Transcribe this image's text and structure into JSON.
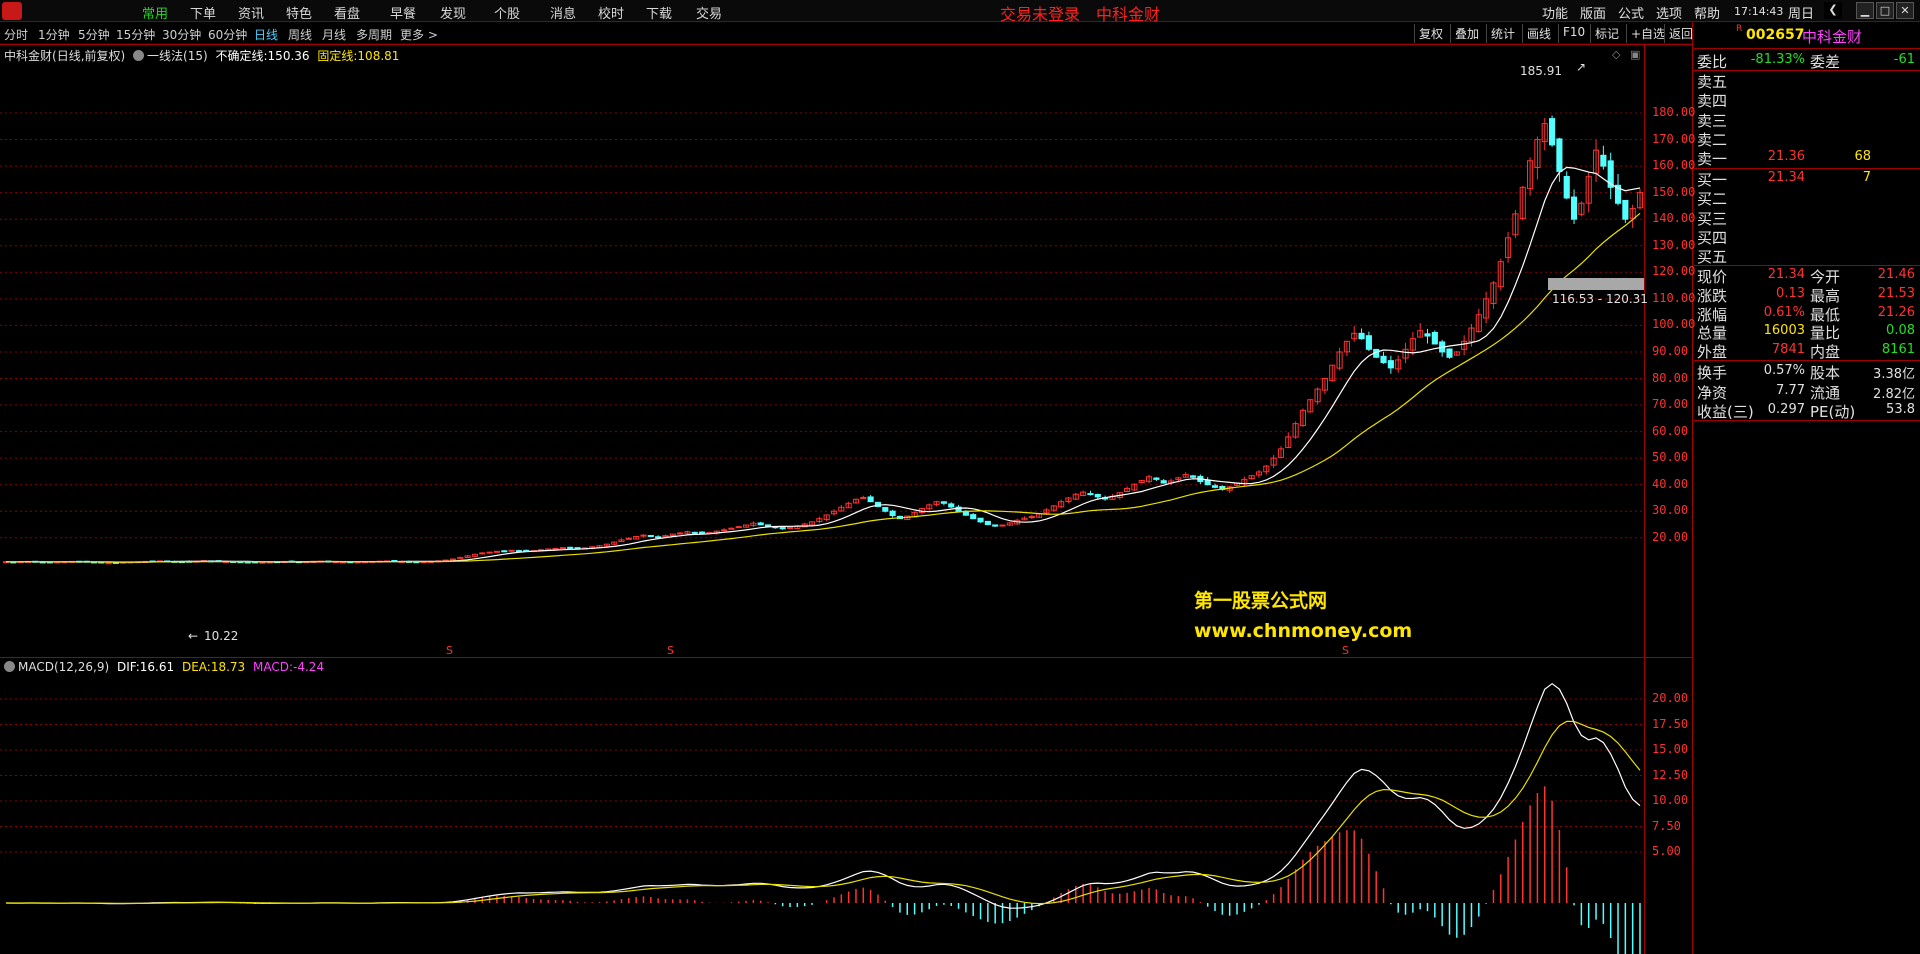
{
  "menu": {
    "items": [
      "常用",
      "下单",
      "资讯",
      "特色",
      "看盘",
      "早餐",
      "发现",
      "个股",
      "消息",
      "校时",
      "下载",
      "交易"
    ],
    "active_index": 0,
    "login_status": "交易未登录",
    "stock_title": "中科金财",
    "right_items": [
      "功能",
      "版面",
      "公式",
      "选项",
      "帮助"
    ],
    "clock": "17:14:43",
    "weekday": "周日"
  },
  "periods": {
    "items": [
      "分时",
      "1分钟",
      "5分钟",
      "15分钟",
      "30分钟",
      "60分钟",
      "日线",
      "周线",
      "月线",
      "多周期",
      "更多 >"
    ],
    "active_index": 6
  },
  "toolbar": [
    "复权",
    "叠加",
    "统计",
    "画线",
    "F10",
    "标记",
    "+自选",
    "返回"
  ],
  "main_legend": {
    "name": "中科金财",
    "mode": "(日线,前复权)",
    "indicator": "一线法(15)",
    "uncertain_label": "不确定线:",
    "uncertain_value": "150.36",
    "fixed_label": "固定线:",
    "fixed_value": "108.81"
  },
  "annotations": {
    "high": "185.91",
    "low": "10.22",
    "range": "116.53 - 120.31",
    "marker": "S"
  },
  "watermark": {
    "line1": "第一股票公式网",
    "line2": "www.chnmoney.com"
  },
  "macd_legend": {
    "name": "MACD(12,26,9)",
    "dif_label": "DIF:",
    "dif_value": "16.61",
    "dea_label": "DEA:",
    "dea_value": "18.73",
    "macd_label": "MACD:",
    "macd_value": "-4.24"
  },
  "colors": {
    "up": "#ff3232",
    "down": "#54ffff",
    "ma1": "#ffffff",
    "ma2": "#e8e000",
    "axis": "#ff3030",
    "grid": "#8a0000"
  },
  "price_axis": [
    "180.00",
    "170.00",
    "160.00",
    "150.00",
    "140.00",
    "130.00",
    "120.00",
    "110.00",
    "100.00",
    "90.00",
    "80.00",
    "70.00",
    "60.00",
    "50.00",
    "40.00",
    "30.00",
    "20.00"
  ],
  "macd_axis": [
    "20.00",
    "17.50",
    "15.00",
    "12.50",
    "10.00",
    "7.50",
    "5.00"
  ],
  "quote": {
    "code": "002657",
    "name": "中科金财",
    "badge": "R",
    "weibi_label": "委比",
    "weibi_value": "-81.33%",
    "weicha_label": "委差",
    "weicha_value": "-61",
    "asks": [
      {
        "label": "卖五",
        "price": "",
        "vol": ""
      },
      {
        "label": "卖四",
        "price": "",
        "vol": ""
      },
      {
        "label": "卖三",
        "price": "",
        "vol": ""
      },
      {
        "label": "卖二",
        "price": "",
        "vol": ""
      },
      {
        "label": "卖一",
        "price": "21.36",
        "vol": "68"
      }
    ],
    "bids": [
      {
        "label": "买一",
        "price": "21.34",
        "vol": "7"
      },
      {
        "label": "买二",
        "price": "",
        "vol": ""
      },
      {
        "label": "买三",
        "price": "",
        "vol": ""
      },
      {
        "label": "买四",
        "price": "",
        "vol": ""
      },
      {
        "label": "买五",
        "price": "",
        "vol": ""
      }
    ],
    "stats": [
      {
        "l1": "现价",
        "v1": "21.34",
        "c1": "#ff3232",
        "l2": "今开",
        "v2": "21.46",
        "c2": "#ff3232"
      },
      {
        "l1": "涨跌",
        "v1": "0.13",
        "c1": "#ff3232",
        "l2": "最高",
        "v2": "21.53",
        "c2": "#ff3232"
      },
      {
        "l1": "涨幅",
        "v1": "0.61%",
        "c1": "#ff3232",
        "l2": "最低",
        "v2": "21.26",
        "c2": "#ff3232"
      },
      {
        "l1": "总量",
        "v1": "16003",
        "c1": "#ffe600",
        "l2": "量比",
        "v2": "0.08",
        "c2": "#20e020"
      },
      {
        "l1": "外盘",
        "v1": "7841",
        "c1": "#ff3232",
        "l2": "内盘",
        "v2": "8161",
        "c2": "#20e020"
      }
    ],
    "fundamentals": [
      {
        "l1": "换手",
        "v1": "0.57%",
        "l2": "股本",
        "v2": "3.38亿"
      },
      {
        "l1": "净资",
        "v1": "7.77",
        "l2": "流通",
        "v2": "2.82亿"
      },
      {
        "l1": "收益(三)",
        "v1": "0.297",
        "l2": "PE(动)",
        "v2": "53.8"
      }
    ]
  },
  "chart_data": {
    "type": "candlestick",
    "description_units": "price",
    "ylim": [
      5,
      190
    ],
    "close": [
      11.0,
      10.9,
      11.0,
      11.1,
      11.0,
      10.9,
      10.8,
      10.9,
      11.0,
      11.1,
      11.0,
      10.9,
      10.8,
      10.7,
      10.6,
      10.7,
      10.8,
      10.9,
      11.0,
      11.1,
      11.2,
      11.3,
      11.2,
      11.1,
      11.0,
      11.1,
      11.2,
      11.4,
      11.3,
      11.2,
      11.1,
      11.0,
      10.9,
      10.8,
      10.7,
      10.8,
      10.9,
      11.0,
      11.1,
      11.0,
      10.9,
      11.0,
      11.1,
      11.2,
      11.1,
      11.0,
      10.9,
      10.8,
      10.9,
      11.0,
      11.1,
      11.2,
      11.3,
      11.2,
      11.1,
      11.0,
      10.9,
      11.0,
      11.1,
      11.3,
      11.6,
      12.0,
      12.6,
      13.2,
      13.8,
      14.3,
      14.6,
      14.9,
      15.1,
      15.3,
      15.1,
      14.9,
      15.2,
      15.5,
      15.8,
      16.0,
      16.3,
      16.1,
      15.9,
      16.2,
      16.6,
      17.0,
      17.6,
      18.4,
      19.2,
      19.8,
      20.5,
      21.0,
      20.6,
      20.2,
      20.8,
      21.4,
      21.8,
      22.3,
      22.0,
      21.6,
      22.0,
      22.5,
      23.0,
      23.6,
      24.2,
      24.8,
      25.5,
      24.9,
      24.3,
      23.8,
      23.4,
      23.9,
      24.5,
      25.2,
      26.0,
      27.2,
      28.6,
      30.0,
      31.5,
      33.0,
      34.5,
      35.2,
      33.6,
      31.8,
      30.0,
      28.4,
      27.2,
      28.2,
      29.6,
      31.0,
      32.4,
      33.6,
      33.0,
      31.6,
      30.0,
      28.5,
      27.2,
      26.0,
      25.0,
      24.4,
      24.8,
      25.6,
      26.6,
      27.4,
      28.0,
      29.0,
      30.5,
      32.0,
      33.6,
      35.0,
      36.4,
      37.2,
      36.6,
      35.4,
      34.6,
      35.6,
      37.0,
      38.6,
      40.2,
      41.6,
      43.0,
      42.0,
      40.6,
      41.4,
      42.6,
      43.8,
      42.8,
      41.2,
      40.0,
      39.0,
      38.2,
      39.2,
      40.6,
      42.0,
      43.4,
      44.8,
      47.0,
      50.0,
      53.5,
      58.0,
      63.0,
      68.0,
      72.0,
      76.0,
      80.0,
      85.0,
      90.0,
      94.0,
      97.0,
      95.0,
      91.0,
      88.0,
      86.0,
      84.0,
      87.0,
      91.0,
      95.0,
      98.0,
      96.0,
      93.0,
      90.0,
      88.0,
      90.0,
      94.0,
      99.0,
      104.0,
      110.0,
      116.0,
      124.0,
      133.0,
      142.0,
      152.0,
      162.0,
      170.0,
      176.0,
      168.0,
      158.0,
      148.0,
      140.0,
      146.0,
      156.0,
      166.0,
      160.0,
      152.0,
      146.0,
      140.0,
      144.0,
      150.0
    ]
  }
}
